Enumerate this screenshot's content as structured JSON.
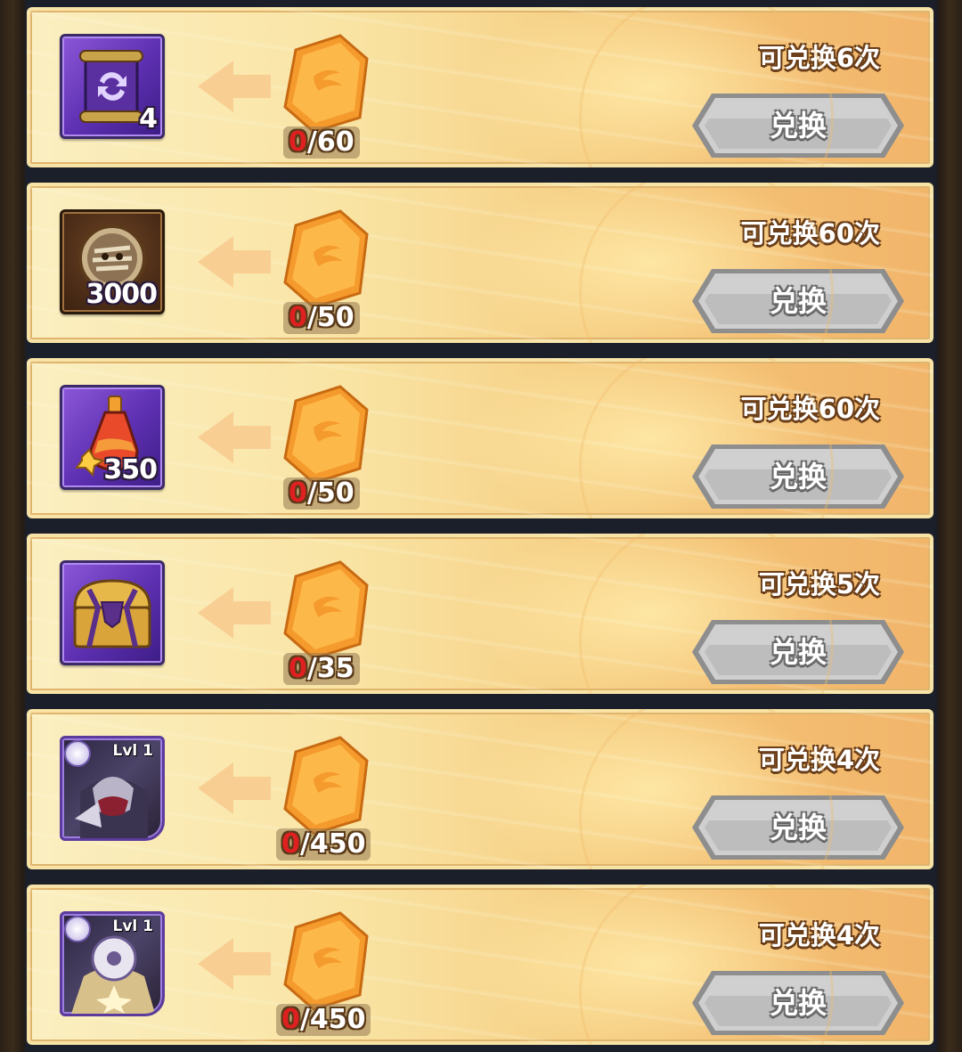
{
  "exchange_rows": [
    {
      "item": "rune-scroll-icon",
      "quantity": "4",
      "level": "",
      "cost_have": "0",
      "cost_need": "/60",
      "limit": "可兑换6次",
      "button": "兑换"
    },
    {
      "item": "mummy-coin-icon",
      "quantity": "3000",
      "level": "",
      "cost_have": "0",
      "cost_need": "/50",
      "limit": "可兑换60次",
      "button": "兑换"
    },
    {
      "item": "potion-icon",
      "quantity": "350",
      "level": "",
      "cost_have": "0",
      "cost_need": "/50",
      "limit": "可兑换60次",
      "button": "兑换"
    },
    {
      "item": "treasure-chest-icon",
      "quantity": "",
      "level": "",
      "cost_have": "0",
      "cost_need": "/35",
      "limit": "可兑换5次",
      "button": "兑换"
    },
    {
      "item": "hero-portrait-armored-icon",
      "quantity": "",
      "level": "Lvl 1",
      "cost_have": "0",
      "cost_need": "/450",
      "limit": "可兑换4次",
      "button": "兑换"
    },
    {
      "item": "hero-portrait-celestial-icon",
      "quantity": "",
      "level": "Lvl 1",
      "cost_have": "0",
      "cost_need": "/450",
      "limit": "可兑换4次",
      "button": "兑换"
    }
  ],
  "colors": {
    "have_count": "#e02020",
    "row_bg_left": "#fbefc1",
    "row_bg_right": "#f1b56a",
    "gem": "#f5a132",
    "button": "#b9b9b9"
  }
}
